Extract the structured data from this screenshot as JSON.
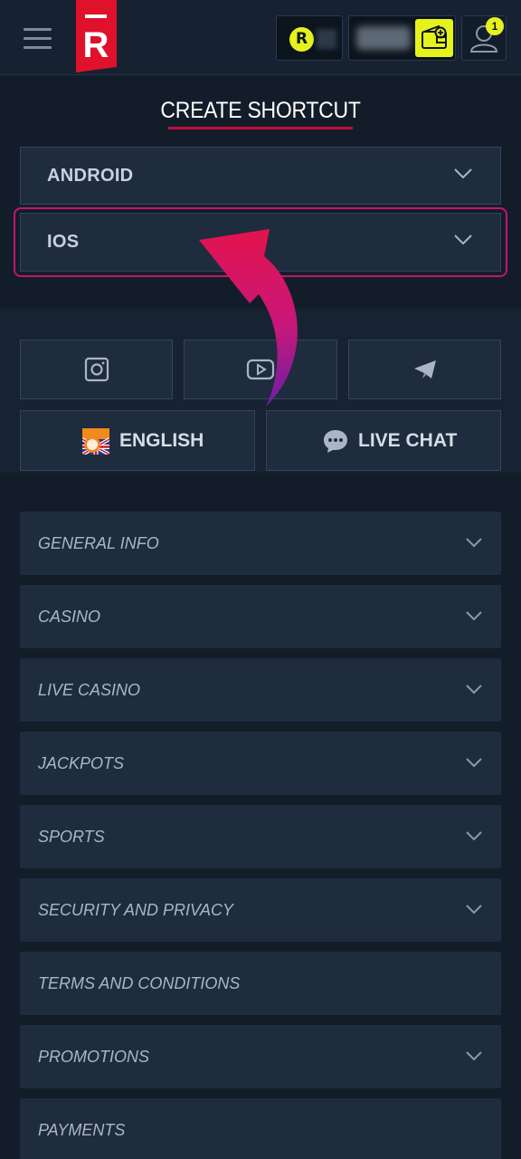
{
  "header": {
    "menu_icon": "hamburger-icon",
    "logo_letter": "R",
    "coin_letter": "R",
    "notification_count": "1",
    "colors": {
      "accent": "#e6f21c",
      "brand": "#e0112b"
    }
  },
  "shortcut": {
    "title": "CREATE SHORTCUT",
    "options": [
      {
        "label": "ANDROID"
      },
      {
        "label": "IOS"
      }
    ]
  },
  "social": {
    "icons": [
      "instagram-icon",
      "youtube-icon",
      "telegram-icon"
    ],
    "language_label": "ENGLISH",
    "live_chat_label": "LIVE CHAT"
  },
  "menu": {
    "items": [
      {
        "label": "GENERAL INFO",
        "expandable": true
      },
      {
        "label": "CASINO",
        "expandable": true
      },
      {
        "label": "LIVE CASINO",
        "expandable": true
      },
      {
        "label": "JACKPOTS",
        "expandable": true
      },
      {
        "label": "SPORTS",
        "expandable": true
      },
      {
        "label": "SECURITY AND PRIVACY",
        "expandable": true
      },
      {
        "label": "TERMS AND CONDITIONS",
        "expandable": false
      },
      {
        "label": "PROMOTIONS",
        "expandable": true
      },
      {
        "label": "PAYMENTS",
        "expandable": false
      }
    ]
  }
}
